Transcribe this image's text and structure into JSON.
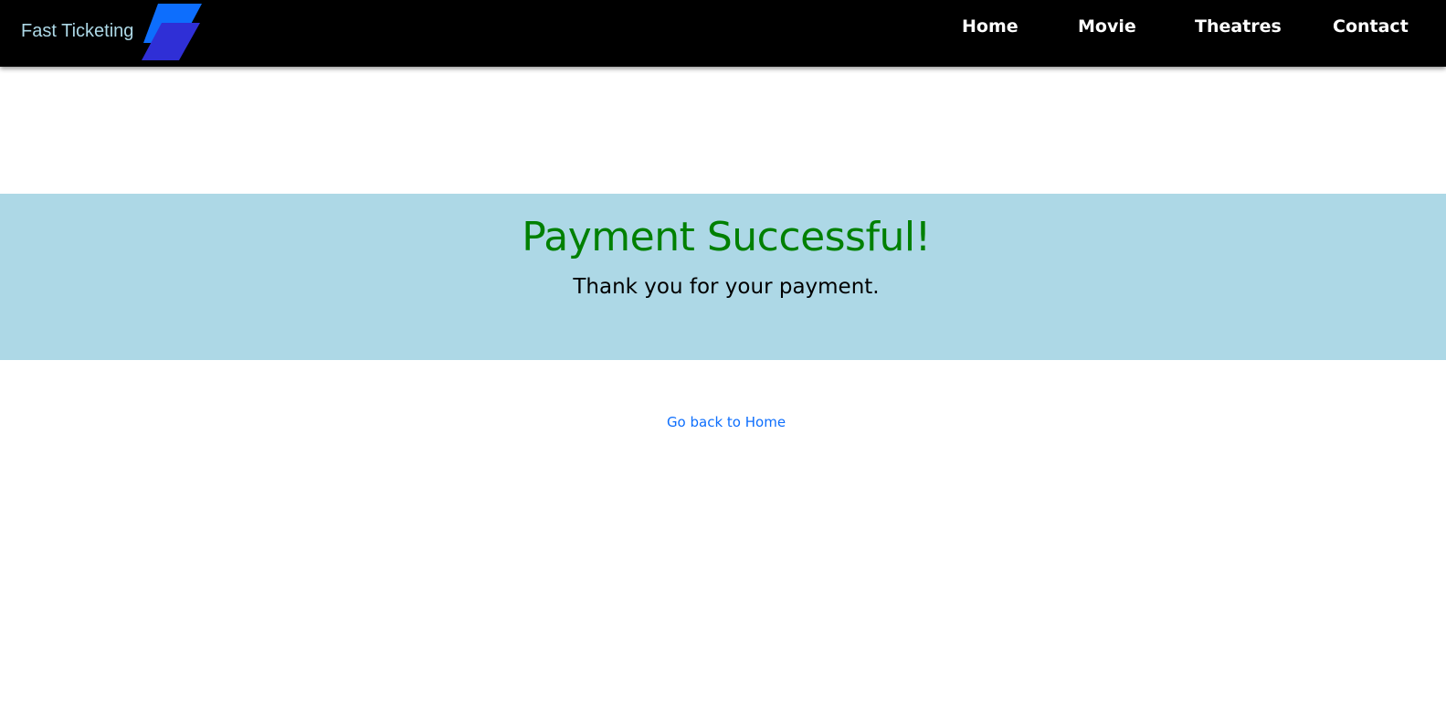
{
  "navbar": {
    "brand_text": "Fast Ticketing",
    "logo_icon": "parallelogram-logo-icon",
    "links": [
      {
        "label": "Home"
      },
      {
        "label": "Movie"
      },
      {
        "label": "Theatres"
      },
      {
        "label": "Contact"
      }
    ]
  },
  "banner": {
    "title": "Payment Successful!",
    "subtitle": "Thank you for your payment."
  },
  "home_link": {
    "label": "Go back to Home"
  },
  "colors": {
    "navbar_bg": "#000000",
    "brand_text": "#add8e6",
    "banner_bg": "#add8e6",
    "title": "#008000",
    "link": "#0d6efd",
    "logo_primary": "#0d6efd",
    "logo_secondary": "#2f2fd6"
  }
}
